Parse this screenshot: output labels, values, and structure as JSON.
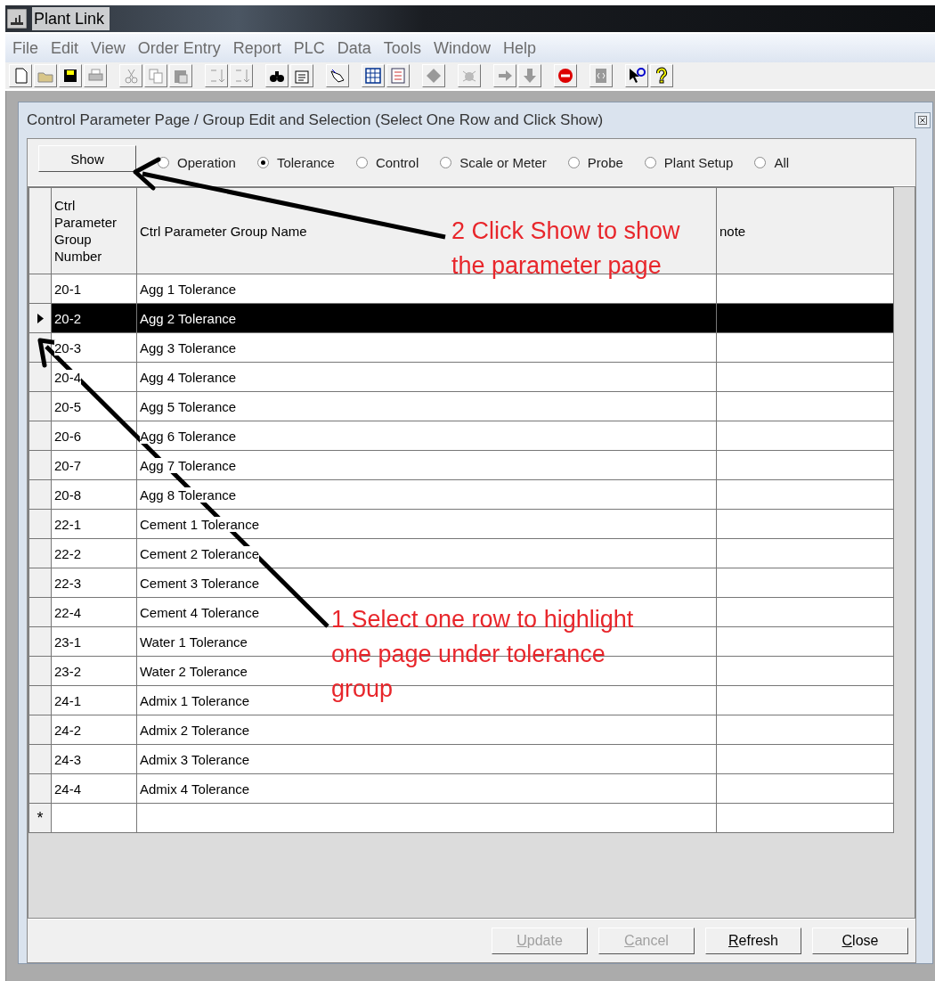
{
  "window": {
    "title": "Plant Link"
  },
  "menu": [
    "File",
    "Edit",
    "View",
    "Order Entry",
    "Report",
    "PLC",
    "Data",
    "Tools",
    "Window",
    "Help"
  ],
  "child_window": {
    "title": "Control Parameter Page / Group Edit and Selection (Select One Row and Click Show)"
  },
  "show_button": "Show",
  "filters": [
    {
      "label": "Operation",
      "selected": false
    },
    {
      "label": "Tolerance",
      "selected": true
    },
    {
      "label": "Control",
      "selected": false
    },
    {
      "label": "Scale or Meter",
      "selected": false
    },
    {
      "label": "Probe",
      "selected": false
    },
    {
      "label": "Plant Setup",
      "selected": false
    },
    {
      "label": "All",
      "selected": false
    }
  ],
  "table": {
    "columns": [
      "Ctrl Parameter Group Number",
      "Ctrl Parameter Group Name",
      "note"
    ],
    "rows": [
      {
        "number": "20-1",
        "name": "Agg 1 Tolerance",
        "selected": false
      },
      {
        "number": "20-2",
        "name": "Agg 2 Tolerance",
        "selected": true
      },
      {
        "number": "20-3",
        "name": "Agg 3 Tolerance",
        "selected": false
      },
      {
        "number": "20-4",
        "name": "Agg 4 Tolerance",
        "selected": false
      },
      {
        "number": "20-5",
        "name": "Agg 5 Tolerance",
        "selected": false
      },
      {
        "number": "20-6",
        "name": "Agg 6 Tolerance",
        "selected": false
      },
      {
        "number": "20-7",
        "name": "Agg 7 Tolerance",
        "selected": false
      },
      {
        "number": "20-8",
        "name": "Agg 8 Tolerance",
        "selected": false
      },
      {
        "number": "22-1",
        "name": "Cement 1 Tolerance",
        "selected": false
      },
      {
        "number": "22-2",
        "name": "Cement 2 Tolerance",
        "selected": false
      },
      {
        "number": "22-3",
        "name": "Cement 3 Tolerance",
        "selected": false
      },
      {
        "number": "22-4",
        "name": "Cement 4 Tolerance",
        "selected": false
      },
      {
        "number": "23-1",
        "name": "Water 1 Tolerance",
        "selected": false
      },
      {
        "number": "23-2",
        "name": "Water 2 Tolerance",
        "selected": false
      },
      {
        "number": "24-1",
        "name": "Admix 1 Tolerance",
        "selected": false
      },
      {
        "number": "24-2",
        "name": "Admix 2 Tolerance",
        "selected": false
      },
      {
        "number": "24-3",
        "name": "Admix 3 Tolerance",
        "selected": false
      },
      {
        "number": "24-4",
        "name": "Admix 4 Tolerance",
        "selected": false
      }
    ],
    "new_row_marker": "*"
  },
  "buttons": [
    {
      "label": "Update",
      "disabled": true
    },
    {
      "label": "Cancel",
      "disabled": true
    },
    {
      "label": "Refresh",
      "disabled": false
    },
    {
      "label": "Close",
      "disabled": false
    }
  ],
  "annotations": [
    {
      "kind": "show",
      "text": "2 Click Show to show\nthe parameter page"
    },
    {
      "kind": "row",
      "text": "1 Select one row to highlight\none page under tolerance\ngroup"
    }
  ]
}
